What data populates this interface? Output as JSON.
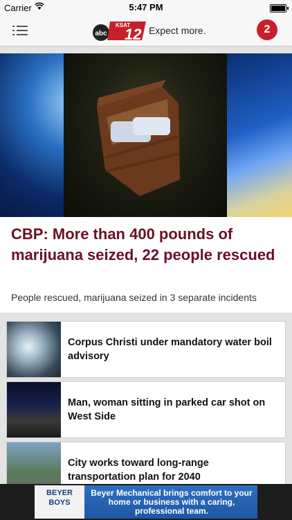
{
  "status_bar": {
    "carrier": "Carrier",
    "time": "5:47 PM",
    "battery_level": 1.0
  },
  "header": {
    "logo_network": "abc",
    "logo_station": "KSAT",
    "logo_channel": "12",
    "tagline": "Expect more.",
    "notification_count": "2"
  },
  "top_story": {
    "headline": "CBP: More than 400 pounds of marijuana seized, 22 people rescued",
    "summary": "People rescued, marijuana seized in 3 separate incidents"
  },
  "stories": [
    {
      "title": "Corpus Christi under mandatory water boil advisory"
    },
    {
      "title": "Man, woman sitting in parked car shot on West Side"
    },
    {
      "title": "City works toward long-range transportation plan for 2040"
    }
  ],
  "ad": {
    "brand": "BEYER BOYS",
    "text": "Beyer Mechanical brings comfort to your home or business with a caring, professional team."
  },
  "colors": {
    "headline": "#6b1026",
    "notification_badge": "#c6202b",
    "brand_red": "#c6202b"
  }
}
